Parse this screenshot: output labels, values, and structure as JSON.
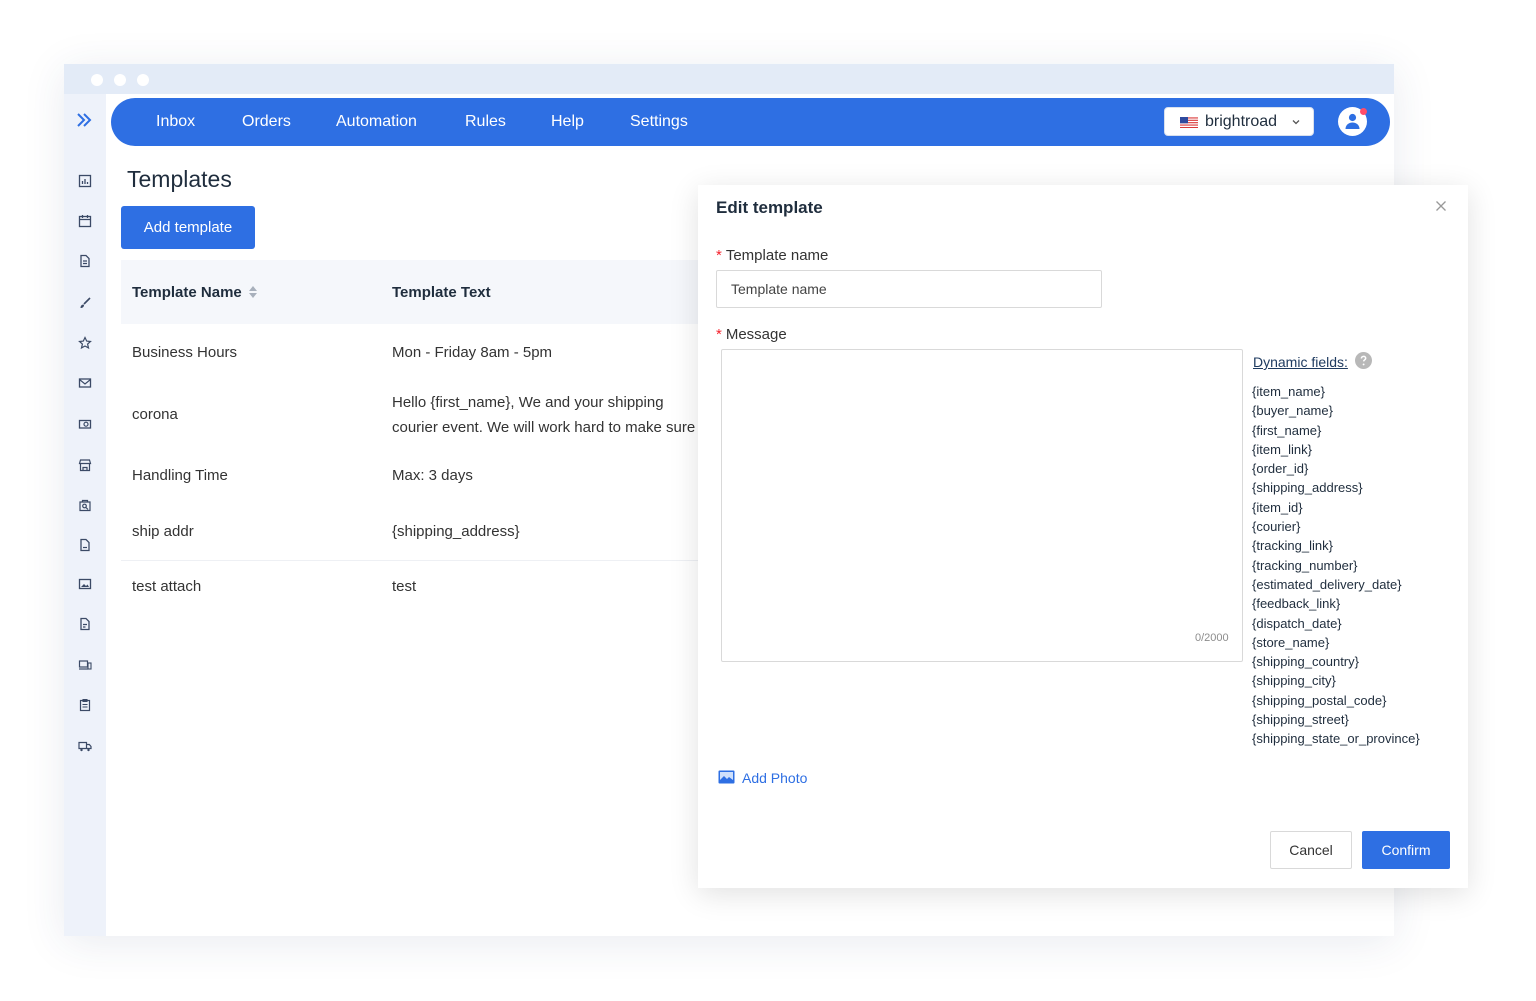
{
  "nav": {
    "items": [
      "Inbox",
      "Orders",
      "Automation",
      "Rules",
      "Help",
      "Settings"
    ],
    "store": "brightroad"
  },
  "page": {
    "title": "Templates",
    "add_button": "Add template"
  },
  "table": {
    "headers": [
      "Template Name",
      "Template Text"
    ],
    "rows": [
      {
        "name": "Business Hours",
        "text": "Mon - Friday 8am - 5pm"
      },
      {
        "name": "corona",
        "text": "Hello {first_name}, We and your shipping courier event. We will work hard to make sure your pa"
      },
      {
        "name": "Handling Time",
        "text": "Max: 3 days"
      },
      {
        "name": "ship addr",
        "text": "{shipping_address}"
      },
      {
        "name": "test attach",
        "text": "test"
      }
    ]
  },
  "modal": {
    "title": "Edit template",
    "name_label": "Template name",
    "name_placeholder": "Template name",
    "message_label": "Message",
    "counter": "0/2000",
    "dynamic_title": "Dynamic fields:",
    "dynamic_fields": [
      "{item_name}",
      "{buyer_name}",
      "{first_name}",
      "{item_link}",
      "{order_id}",
      "{shipping_address}",
      "{item_id}",
      "{courier}",
      "{tracking_link}",
      "{tracking_number}",
      "{estimated_delivery_date}",
      "{feedback_link}",
      "{dispatch_date}",
      "{store_name}",
      "{shipping_country}",
      "{shipping_city}",
      "{shipping_postal_code}",
      "{shipping_street}",
      "{shipping_state_or_province}"
    ],
    "add_photo": "Add Photo",
    "cancel": "Cancel",
    "confirm": "Confirm"
  },
  "colors": {
    "primary": "#2e6fe3",
    "titlebar": "#e3ebf7",
    "sidebar": "#eef2fa",
    "required": "#f5222d"
  },
  "icons": {
    "sidebar": [
      "chart-icon",
      "calendar-icon",
      "document-icon",
      "brush-icon",
      "star-icon",
      "mail-icon",
      "camera-icon",
      "store-icon",
      "bag-search-icon",
      "file-icon",
      "image-icon",
      "file-text-icon",
      "devices-icon",
      "clipboard-icon",
      "truck-icon"
    ]
  }
}
